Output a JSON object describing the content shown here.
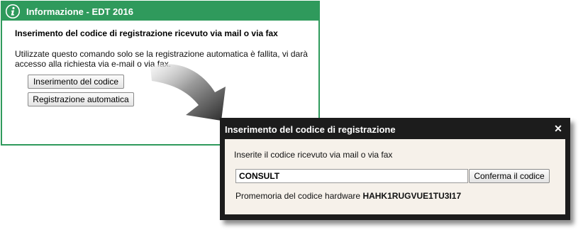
{
  "info_dialog": {
    "title": "Informazione - EDT 2016",
    "icon": "info-icon",
    "heading": "Inserimento del codice di registrazione ricevuto via mail o via fax",
    "description": "Utilizzate questo comando solo se la registrazione automatica è fallita, vi darà accesso alla richiesta via e-mail o via fax.",
    "buttons": {
      "insert_code": "Inserimento del codice",
      "auto_registration": "Registrazione automatica"
    },
    "accent_color": "#2f9a5c"
  },
  "registration_dialog": {
    "title": "Inserimento del codice di registrazione",
    "close_icon": "close-icon",
    "instruction": "Inserite il codice ricevuto via mail o via fax",
    "code_input": {
      "value": "CONSULT"
    },
    "confirm_button": "Conferma il codice",
    "hardware_label": "Promemoria del codice hardware",
    "hardware_code": "HAHK1RUGVUE1TU3I17"
  }
}
